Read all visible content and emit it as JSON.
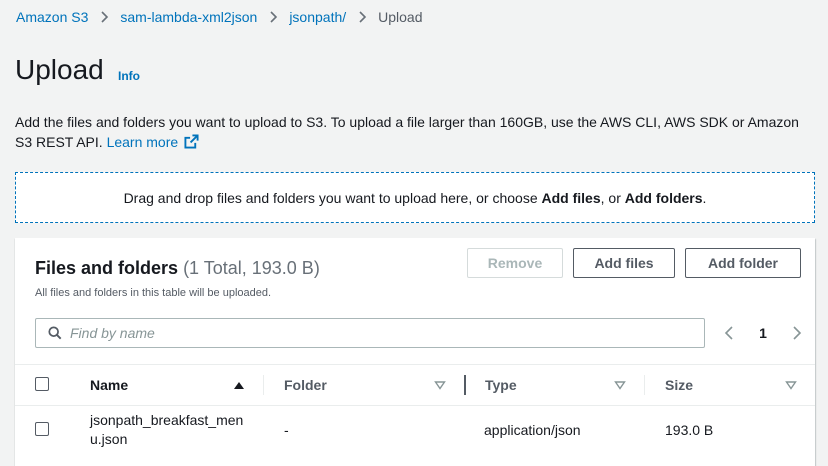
{
  "breadcrumb": {
    "items": [
      "Amazon S3",
      "sam-lambda-xml2json",
      "jsonpath/"
    ],
    "current": "Upload"
  },
  "header": {
    "title": "Upload",
    "info": "Info"
  },
  "description": {
    "text": "Add the files and folders you want to upload to S3. To upload a file larger than 160GB, use the AWS CLI, AWS SDK or Amazon S3 REST API.",
    "learn_more": "Learn more"
  },
  "dropzone": {
    "prefix": "Drag and drop files and folders you want to upload here, or choose ",
    "add_files": "Add files",
    "middle": ", or ",
    "add_folders": "Add folders",
    "suffix": "."
  },
  "files_panel": {
    "title": "Files and folders",
    "count": "(1 Total, 193.0 B)",
    "subtitle": "All files and folders in this table will be uploaded.",
    "buttons": {
      "remove": "Remove",
      "add_files": "Add files",
      "add_folder": "Add folder"
    },
    "search_placeholder": "Find by name",
    "page": "1",
    "columns": [
      "Name",
      "Folder",
      "Type",
      "Size"
    ],
    "rows": [
      {
        "name": "jsonpath_breakfast_menu.json",
        "folder": "-",
        "type": "application/json",
        "size": "193.0 B"
      }
    ]
  },
  "icons": {
    "breadcrumb_separator": "chevron-right-icon",
    "learn_more": "external-link-icon",
    "search": "search-icon",
    "sort_name": "sort-ascending-icon",
    "sort_other": "sort-descending-icon"
  },
  "colors": {
    "link": "#0073bb",
    "text": "#16191f",
    "background": "#f2f3f3",
    "disabled": "#aab7b8"
  }
}
